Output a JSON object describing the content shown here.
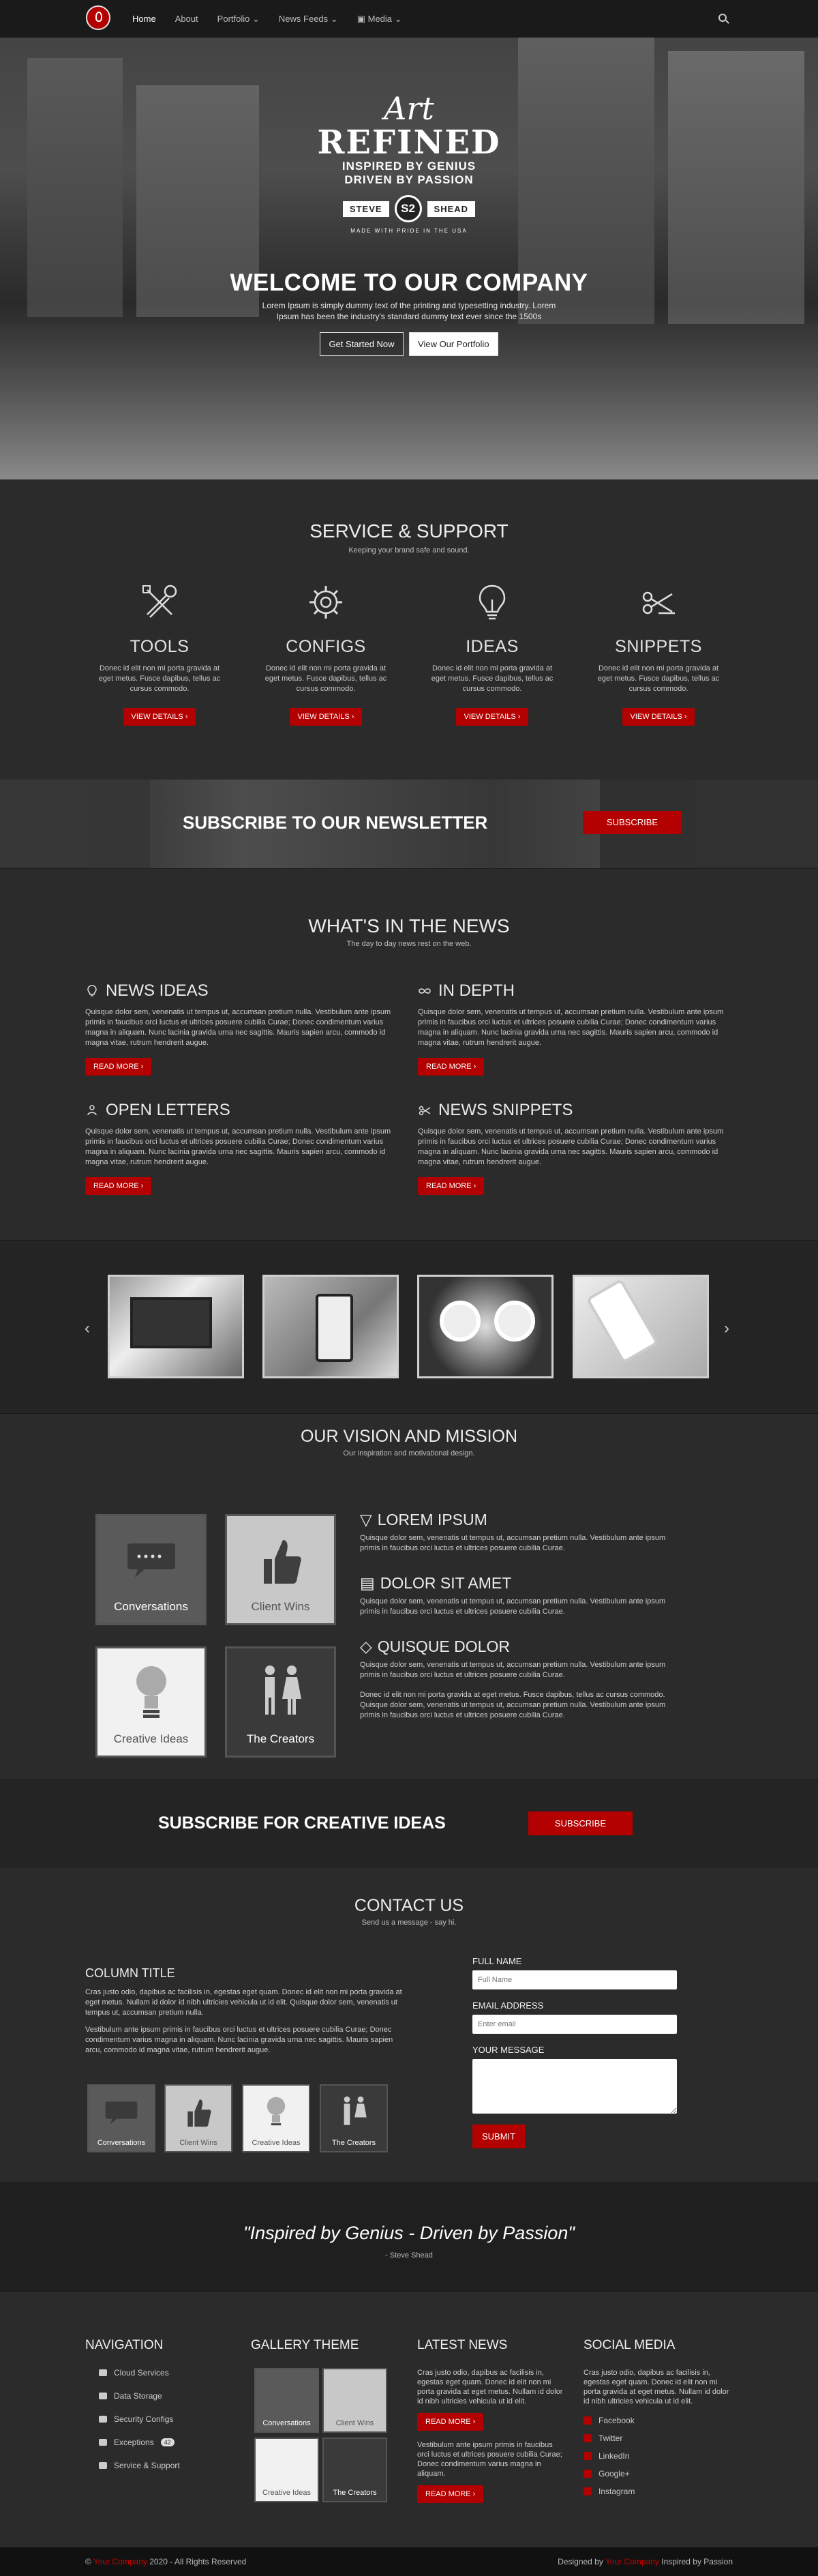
{
  "nav": {
    "items": [
      "Home",
      "About",
      "Portfolio",
      "News Feeds",
      "Media"
    ],
    "dropdown_marker": "⌄"
  },
  "hero": {
    "badge": {
      "art": "Art",
      "refined": "REFINED",
      "line1": "INSPIRED BY GENIUS",
      "line2": "DRIVEN BY PASSION",
      "left": "STEVE",
      "center": "S2",
      "right": "SHEAD",
      "made": "MADE WITH PRIDE IN THE USA"
    },
    "title": "WELCOME TO OUR COMPANY",
    "text": "Lorem Ipsum is simply dummy text of the printing and typesetting industry. Lorem Ipsum has been the industry's standard dummy text ever since the 1500s",
    "btn_primary": "Get Started Now",
    "btn_secondary": "View Our Portfolio"
  },
  "services": {
    "title": "SERVICE & SUPPORT",
    "subtitle": "Keeping your brand safe and sound.",
    "items": [
      {
        "name": "TOOLS",
        "icon": "tools-icon",
        "text": "Donec id elit non mi porta gravida at eget metus. Fusce dapibus, tellus ac cursus commodo.",
        "btn": "VIEW DETAILS"
      },
      {
        "name": "CONFIGS",
        "icon": "gear-icon",
        "text": "Donec id elit non mi porta gravida at eget metus. Fusce dapibus, tellus ac cursus commodo.",
        "btn": "VIEW DETAILS"
      },
      {
        "name": "IDEAS",
        "icon": "lightbulb-icon",
        "text": "Donec id elit non mi porta gravida at eget metus. Fusce dapibus, tellus ac cursus commodo.",
        "btn": "VIEW DETAILS"
      },
      {
        "name": "SNIPPETS",
        "icon": "snippets-icon",
        "text": "Donec id elit non mi porta gravida at eget metus. Fusce dapibus, tellus ac cursus commodo.",
        "btn": "VIEW DETAILS"
      }
    ]
  },
  "newsletter": {
    "title": "SUBSCRIBE TO OUR NEWSLETTER",
    "btn": "SUBSCRIBE"
  },
  "news": {
    "title": "WHAT'S IN THE NEWS",
    "subtitle": "The day to day news rest on the web.",
    "items": [
      {
        "title": "NEWS IDEAS",
        "icon": "lightbulb-icon",
        "text": "Quisque dolor sem, venenatis ut tempus ut, accumsan pretium nulla. Vestibulum ante ipsum primis in faucibus orci luctus et ultrices posuere cubilia Curae; Donec condimentum varius magna in aliquam. Nunc lacinia gravida urna nec sagittis. Mauris sapien arcu, commodo id magna vitae, rutrum hendrerit augue.",
        "btn": "READ MORE"
      },
      {
        "title": "IN DEPTH",
        "icon": "infinity-icon",
        "text": "Quisque dolor sem, venenatis ut tempus ut, accumsan pretium nulla. Vestibulum ante ipsum primis in faucibus orci luctus et ultrices posuere cubilia Curae; Donec condimentum varius magna in aliquam. Nunc lacinia gravida urna nec sagittis. Mauris sapien arcu, commodo id magna vitae, rutrum hendrerit augue.",
        "btn": "READ MORE"
      },
      {
        "title": "OPEN LETTERS",
        "icon": "people-icon",
        "text": "Quisque dolor sem, venenatis ut tempus ut, accumsan pretium nulla. Vestibulum ante ipsum primis in faucibus orci luctus et ultrices posuere cubilia Curae; Donec condimentum varius magna in aliquam. Nunc lacinia gravida urna nec sagittis. Mauris sapien arcu, commodo id magna vitae, rutrum hendrerit augue.",
        "btn": "READ MORE"
      },
      {
        "title": "NEWS SNIPPETS",
        "icon": "scissors-icon",
        "text": "Quisque dolor sem, venenatis ut tempus ut, accumsan pretium nulla. Vestibulum ante ipsum primis in faucibus orci luctus et ultrices posuere cubilia Curae; Donec condimentum varius magna in aliquam. Nunc lacinia gravida urna nec sagittis. Mauris sapien arcu, commodo id magna vitae, rutrum hendrerit augue.",
        "btn": "READ MORE"
      }
    ]
  },
  "gallery": {
    "prev": "‹",
    "next": "›"
  },
  "vision": {
    "title": "OUR VISION AND MISSION",
    "subtitle": "Our inspiration and motivational design.",
    "tiles": [
      "Conversations",
      "Client Wins",
      "Creative Ideas",
      "The Creators"
    ],
    "items": [
      {
        "title": "LOREM IPSUM",
        "icon": "filter-icon",
        "text": "Quisque dolor sem, venenatis ut tempus ut, accumsan pretium nulla. Vestibulum ante ipsum primis in faucibus orci luctus et ultrices posuere cubilia Curae."
      },
      {
        "title": "DOLOR SIT AMET",
        "icon": "document-icon",
        "text": "Quisque dolor sem, venenatis ut tempus ut, accumsan pretium nulla. Vestibulum ante ipsum primis in faucibus orci luctus et ultrices posuere cubilia Curae."
      },
      {
        "title": "QUISQUE DOLOR",
        "icon": "diamond-icon",
        "text": "Quisque dolor sem, venenatis ut tempus ut, accumsan pretium nulla. Vestibulum ante ipsum primis in faucibus orci luctus et ultrices posuere cubilia Curae."
      }
    ],
    "extra": "Donec id elit non mi porta gravida at eget metus. Fusce dapibus, tellus ac cursus commodo. Quisque dolor sem, venenatis ut tempus ut, accumsan pretium nulla. Vestibulum ante ipsum primis in faucibus orci luctus et ultrices posuere cubilia Curae."
  },
  "subideas": {
    "title": "SUBSCRIBE FOR CREATIVE IDEAS",
    "btn": "SUBSCRIBE"
  },
  "contact": {
    "title": "CONTACT US",
    "subtitle": "Send us a message - say hi.",
    "col_title": "COLUMN TITLE",
    "p1": "Cras justo odio, dapibus ac facilisis in, egestas eget quam. Donec id elit non mi porta gravida at eget metus. Nullam id dolor id nibh ultricies vehicula ut id elit.  Quisque dolor sem, venenatis ut tempus ut, accumsan pretium nulla.",
    "p2": "Vestibulum ante ipsum primis in faucibus orci luctus et ultrices posuere cubilia Curae; Donec condimentum varius magna in aliquam. Nunc lacinia gravida urna nec sagittis. Mauris sapien arcu, commodo id magna vitae, rutrum hendrerit augue.",
    "tiles": [
      "Conversations",
      "Client Wins",
      "Creative Ideas",
      "The Creators"
    ],
    "form": {
      "name_label": "FULL NAME",
      "name_ph": "Full Name",
      "email_label": "EMAIL ADDRESS",
      "email_ph": "Enter email",
      "msg_label": "YOUR MESSAGE",
      "submit": "SUBMIT"
    }
  },
  "quote": {
    "text": "\"Inspired by Genius - Driven by Passion\"",
    "author": "- Steve Shead"
  },
  "footer": {
    "navigation": {
      "title": "NAVIGATION",
      "links": [
        "Cloud Services",
        "Data Storage",
        "Security Configs",
        "Exceptions",
        "Service & Support"
      ],
      "badge": "42"
    },
    "gallery": {
      "title": "GALLERY THEME",
      "tiles": [
        "Conversations",
        "Client Wins",
        "Creative Ideas",
        "The Creators"
      ]
    },
    "news": {
      "title": "LATEST NEWS",
      "p1": "Cras justo odio, dapibus ac facilisis in, egestas eget quam. Donec id elit non mi porta gravida at eget metus. Nullam id dolor id nibh ultricies vehicula ut id elit.",
      "btn": "READ MORE",
      "p2": "Vestibulum ante ipsum primis in faucibus orci luctus et ultrices posuere cubilia Curae; Donec condimentum varius magna in aliquam.",
      "btn2": "READ MORE"
    },
    "social": {
      "title": "SOCIAL MEDIA",
      "p": "Cras justo odio, dapibus ac facilisis in, egestas eget quam. Donec id elit non mi porta gravida at eget metus. Nullam id dolor id nibh ultricies vehicula ut id elit.",
      "links": [
        "Facebook",
        "Twitter",
        "LinkedIn",
        "Google+",
        "Instagram"
      ]
    }
  },
  "bottom": {
    "left_pre": "©",
    "left_link": "Your Company",
    "left_post": "2020 - All Rights Reserved",
    "right_pre": "Designed by",
    "right_link": "Your Company",
    "right_post": "Inspired by Passion"
  },
  "colors": {
    "accent": "#b30000",
    "bg": "#2b2b2b"
  }
}
